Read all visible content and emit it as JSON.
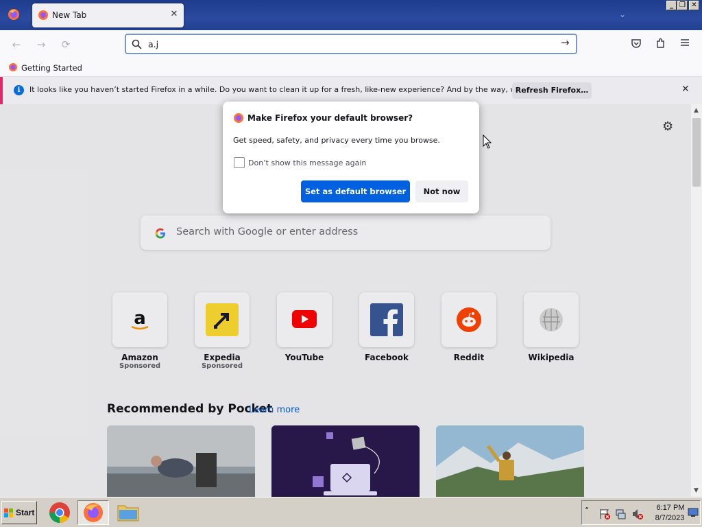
{
  "window": {
    "minimize": "_",
    "restore": "❐",
    "close": "✕"
  },
  "tab": {
    "title": "New Tab",
    "close": "✕",
    "list_icon": "chevron-down-icon"
  },
  "nav": {
    "url_value": "a.j",
    "back": "←",
    "forward": "→",
    "reload": "⟳",
    "go": "→"
  },
  "toolbar_icons": [
    "pocket-icon",
    "extensions-icon",
    "menu-icon"
  ],
  "bookmarks": [
    {
      "label": "Getting Started"
    }
  ],
  "notification": {
    "text": "It looks like you haven’t started Firefox in a while. Do you want to clean it up for a fresh, like-new experience? And by the way, welcome back!",
    "button": "Refresh Firefox…",
    "close": "✕"
  },
  "dialog": {
    "title": "Make Firefox your default browser?",
    "body": "Get speed, safety, and privacy every time you browse.",
    "checkbox_label": "Don’t show this message again",
    "checkbox_checked": false,
    "primary_button": "Set as default browser",
    "secondary_button": "Not now"
  },
  "newtab": {
    "search_placeholder": "Search with Google or enter address",
    "top_sites": [
      {
        "name": "Amazon",
        "sponsored": "Sponsored"
      },
      {
        "name": "Expedia",
        "sponsored": "Sponsored"
      },
      {
        "name": "YouTube",
        "sponsored": ""
      },
      {
        "name": "Facebook",
        "sponsored": ""
      },
      {
        "name": "Reddit",
        "sponsored": ""
      },
      {
        "name": "Wikipedia",
        "sponsored": ""
      }
    ],
    "pocket_title": "Recommended by Pocket",
    "pocket_link": "Learn more"
  },
  "taskbar": {
    "start_label": "Start",
    "time": "6:17 PM",
    "date": "8/7/2023",
    "tray_expand": "˄"
  },
  "colors": {
    "accent": "#0061e0",
    "notification_bar": "#e4266a",
    "titlebar": "#2a4aa0"
  }
}
